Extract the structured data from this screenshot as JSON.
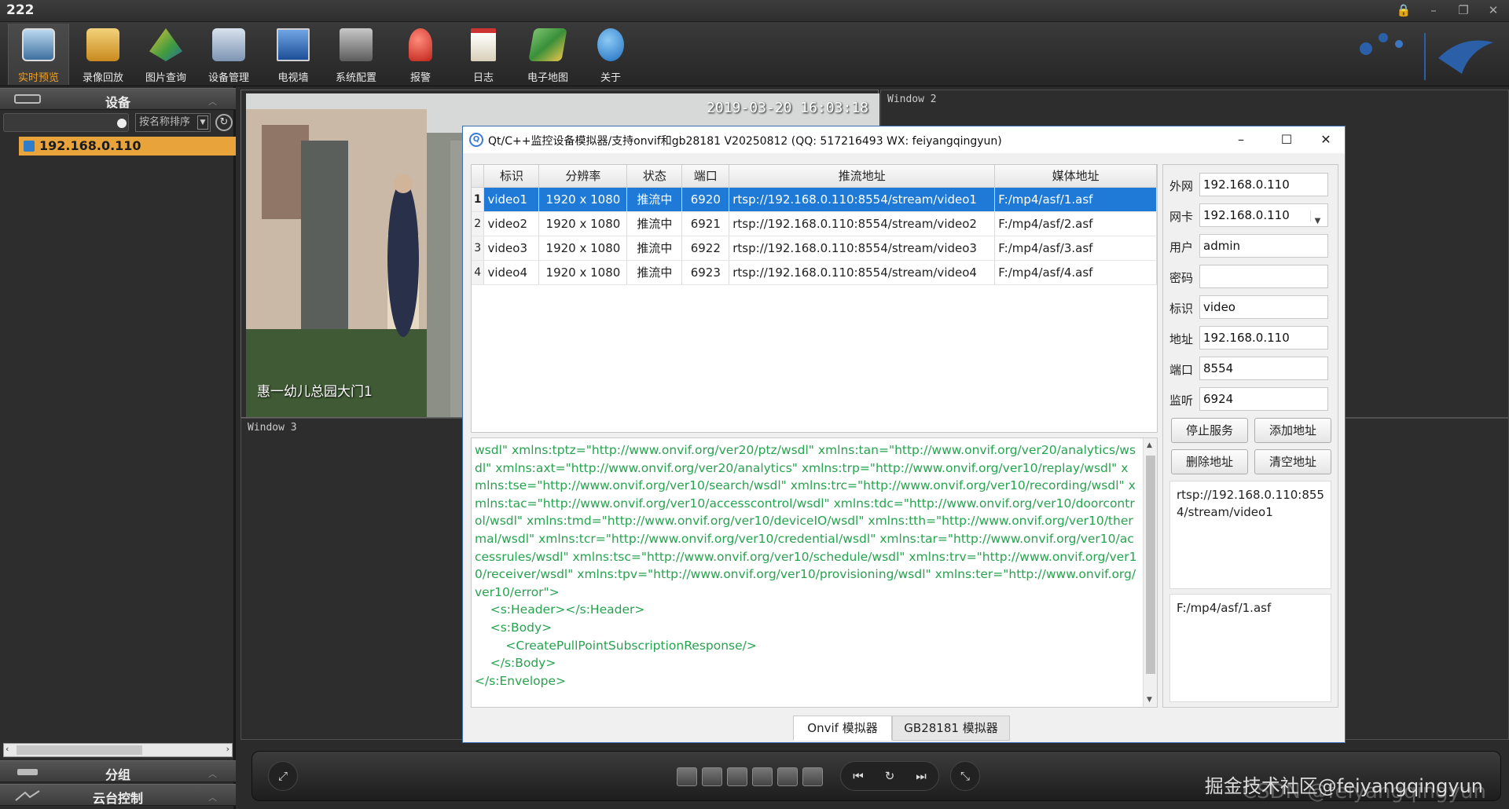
{
  "app": {
    "title": "222"
  },
  "toolbar": {
    "items": [
      {
        "label": "实时预览",
        "icon": "monitor-icon",
        "color": "#6aa7d8"
      },
      {
        "label": "录像回放",
        "icon": "playback-folder-icon",
        "color": "#d9a83a"
      },
      {
        "label": "图片查询",
        "icon": "picture-search-icon",
        "color": "#3f9b3f"
      },
      {
        "label": "设备管理",
        "icon": "device-manage-icon",
        "color": "#8fa6c2"
      },
      {
        "label": "电视墙",
        "icon": "tv-wall-icon",
        "color": "#3a6fb6"
      },
      {
        "label": "系统配置",
        "icon": "system-config-icon",
        "color": "#8c8c8c"
      },
      {
        "label": "报警",
        "icon": "alarm-icon",
        "color": "#d23a2a"
      },
      {
        "label": "日志",
        "icon": "log-icon",
        "color": "#e0d6c0"
      },
      {
        "label": "电子地图",
        "icon": "map-icon",
        "color": "#5aa85a"
      },
      {
        "label": "关于",
        "icon": "about-icon",
        "color": "#3b8ed8"
      }
    ],
    "active_index": 0
  },
  "left_panel": {
    "device_header": "设备",
    "sort_select": "按名称排序",
    "device_item": "192.168.0.110",
    "group_header": "分组",
    "ptz_header": "云台控制"
  },
  "video": {
    "timestamp": "2019-03-20  16:03:18",
    "camera_name": "惠一幼儿总园大门1",
    "window2_label": "Window 2",
    "window3_label": "Window 3"
  },
  "bottom": {
    "watermark": "掘金技术社区@feiyangqingyun",
    "watermark2": "CSDN @feiyangqingyun"
  },
  "dialog": {
    "title": "Qt/C++监控设备模拟器/支持onvif和gb28181 V20250812 (QQ: 517216493 WX: feiyangqingyun)",
    "table": {
      "headers": [
        "标识",
        "分辨率",
        "状态",
        "端口",
        "推流地址",
        "媒体地址"
      ],
      "rows": [
        {
          "num": "1",
          "id": "video1",
          "res": "1920 x 1080",
          "status": "推流中",
          "port": "6920",
          "push": "rtsp://192.168.0.110:8554/stream/video1",
          "media": "F:/mp4/asf/1.asf"
        },
        {
          "num": "2",
          "id": "video2",
          "res": "1920 x 1080",
          "status": "推流中",
          "port": "6921",
          "push": "rtsp://192.168.0.110:8554/stream/video2",
          "media": "F:/mp4/asf/2.asf"
        },
        {
          "num": "3",
          "id": "video3",
          "res": "1920 x 1080",
          "status": "推流中",
          "port": "6922",
          "push": "rtsp://192.168.0.110:8554/stream/video3",
          "media": "F:/mp4/asf/3.asf"
        },
        {
          "num": "4",
          "id": "video4",
          "res": "1920 x 1080",
          "status": "推流中",
          "port": "6923",
          "push": "rtsp://192.168.0.110:8554/stream/video4",
          "media": "F:/mp4/asf/4.asf"
        }
      ],
      "selected_index": 0
    },
    "log": "wsdl\" xmlns:tptz=\"http://www.onvif.org/ver20/ptz/wsdl\" xmlns:tan=\"http://www.onvif.org/ver20/analytics/wsdl\" xmlns:axt=\"http://www.onvif.org/ver20/analytics\" xmlns:trp=\"http://www.onvif.org/ver10/replay/wsdl\" xmlns:tse=\"http://www.onvif.org/ver10/search/wsdl\" xmlns:trc=\"http://www.onvif.org/ver10/recording/wsdl\" xmlns:tac=\"http://www.onvif.org/ver10/accesscontrol/wsdl\" xmlns:tdc=\"http://www.onvif.org/ver10/doorcontrol/wsdl\" xmlns:tmd=\"http://www.onvif.org/ver10/deviceIO/wsdl\" xmlns:tth=\"http://www.onvif.org/ver10/thermal/wsdl\" xmlns:tcr=\"http://www.onvif.org/ver10/credential/wsdl\" xmlns:tar=\"http://www.onvif.org/ver10/accessrules/wsdl\" xmlns:tsc=\"http://www.onvif.org/ver10/schedule/wsdl\" xmlns:trv=\"http://www.onvif.org/ver10/receiver/wsdl\" xmlns:tpv=\"http://www.onvif.org/ver10/provisioning/wsdl\" xmlns:ter=\"http://www.onvif.org/ver10/error\">\n    <s:Header></s:Header>\n    <s:Body>\n        <CreatePullPointSubscriptionResponse/>\n    </s:Body>\n</s:Envelope>",
    "form": {
      "wan_label": "外网",
      "wan_value": "192.168.0.110",
      "nic_label": "网卡",
      "nic_value": "192.168.0.110",
      "user_label": "用户",
      "user_value": "admin",
      "pass_label": "密码",
      "pass_value": "",
      "id_label": "标识",
      "id_value": "video",
      "addr_label": "地址",
      "addr_value": "192.168.0.110",
      "port_label": "端口",
      "port_value": "8554",
      "listen_label": "监听",
      "listen_value": "6924",
      "stop_btn": "停止服务",
      "add_btn": "添加地址",
      "del_btn": "删除地址",
      "clear_btn": "清空地址",
      "url_box": "rtsp://192.168.0.110:8554/stream/video1",
      "media_box": "F:/mp4/asf/1.asf"
    },
    "tabs": [
      "Onvif 模拟器",
      "GB28181 模拟器"
    ],
    "active_tab": 0
  }
}
